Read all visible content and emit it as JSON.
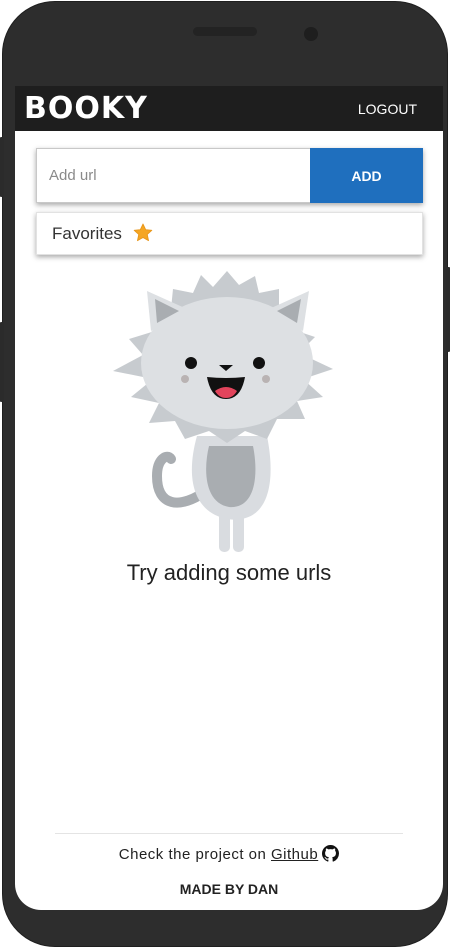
{
  "header": {
    "brand": "BOOKY",
    "logout_label": "LOGOUT"
  },
  "url_form": {
    "placeholder": "Add url",
    "value": "",
    "add_label": "ADD"
  },
  "favorites": {
    "label": "Favorites",
    "icon": "star-icon"
  },
  "empty_state": {
    "illustration": "cat-illustration",
    "message": "Try adding some urls"
  },
  "footer": {
    "prefix": "Check the project on ",
    "link_label": "Github",
    "link_icon": "github-icon",
    "credit": "MADE BY DAN"
  },
  "colors": {
    "topbar": "#1e1e1e",
    "accent": "#1f6fbe",
    "star": "#f5a623",
    "phone_frame": "#2d2d2d"
  }
}
